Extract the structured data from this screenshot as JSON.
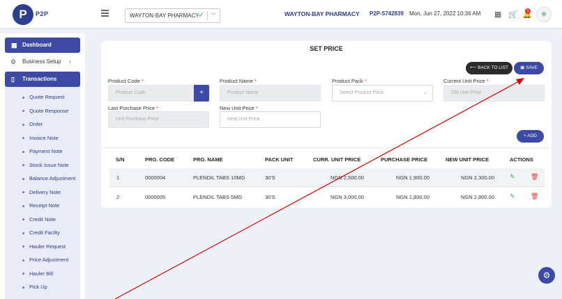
{
  "header": {
    "logo_letter": "P",
    "logo_text": "P2P",
    "store_select": "WAYTON-BAY PHARMACY",
    "pharmacy_name": "WAYTON-BAY PHARMACY",
    "account_code": "P2P-5742839",
    "datetime": "Mon, Jun 27, 2022 10:36 AM",
    "notification_count": "1"
  },
  "sidebar": {
    "dashboard": "Dashboard",
    "business_setup": "Business Setup",
    "transactions": "Transactions",
    "items": [
      "Quote Request",
      "Quote Response",
      "Order",
      "Invoice Note",
      "Payment Note",
      "Stock Issue Note",
      "Balance Adjustment",
      "Delivery Note",
      "Receipt Note",
      "Credit Note",
      "Credit Facilty",
      "Hauler Request",
      "Price Adjustment",
      "Hauler Bill",
      "Pick Up"
    ]
  },
  "form": {
    "title": "SET PRICE",
    "back_label": "BACK TO LIST",
    "save_label": "SAVE",
    "add_label": "+ ADD",
    "product_code": {
      "label": "Product Code",
      "placeholder": "Product Code"
    },
    "product_name": {
      "label": "Product Name",
      "placeholder": "Product Name"
    },
    "product_pack": {
      "label": "Product Pack",
      "placeholder": "Select Product Pack"
    },
    "current_price": {
      "label": "Current Unit Price",
      "placeholder": "Old Unit Price"
    },
    "last_price": {
      "label": "Last Purchase Price",
      "placeholder": "Unit Purchase Price"
    },
    "new_price": {
      "label": "New Unit Price",
      "placeholder": "New Unit Price"
    }
  },
  "table": {
    "headers": [
      "S/N",
      "PRO. CODE",
      "PRO. NAME",
      "PACK UNIT",
      "CURR. UNIT PRICE",
      "PURCHASE PRICE",
      "NEW UNIT PRICE",
      "ACTIONS"
    ],
    "rows": [
      [
        "1",
        "0000004",
        "PLENDIL TABS 10MG",
        "30'S",
        "NGN 2,500.00",
        "NGN 1,900.00",
        "NGN 2,300.00"
      ],
      [
        "2",
        "0000005",
        "PLENDIL TABS 5MG",
        "30'S",
        "NGN 3,000.00",
        "NGN 1,800.00",
        "NGN 2,800.00"
      ]
    ]
  },
  "colors": {
    "primary": "#3d4aa5",
    "annotation_line": "#d40000"
  }
}
